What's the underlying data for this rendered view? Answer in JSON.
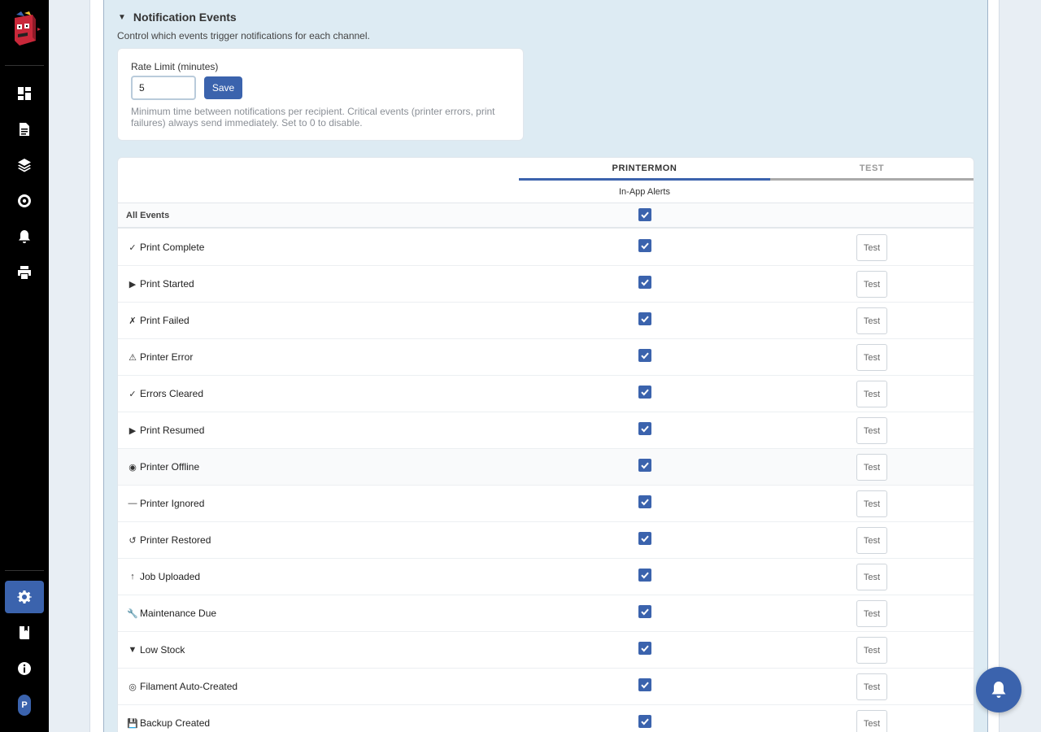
{
  "sidebar": {
    "nav_icons": [
      "dashboard-icon",
      "document-icon",
      "layers-icon",
      "filament-spool-icon",
      "bell-icon",
      "printer-icon"
    ],
    "bottom_icons": [
      "gear-icon",
      "book-icon",
      "info-icon"
    ],
    "user_initial": "P",
    "accent": "#3b63ad"
  },
  "section": {
    "caret": "▼",
    "title": "Notification Events",
    "description": "Control which events trigger notifications for each channel."
  },
  "rate_limit": {
    "label": "Rate Limit (minutes)",
    "value": "5",
    "save_label": "Save",
    "help": "Minimum time between notifications per recipient. Critical events (printer errors, print failures) always send immediately. Set to 0 to disable."
  },
  "table": {
    "columns": [
      {
        "name": "PRINTERMON",
        "sub": "In-App Alerts"
      },
      {
        "name": "TEST",
        "sub": ""
      }
    ],
    "all_events_label": "All Events",
    "test_label": "Test",
    "events": [
      {
        "icon": "✓",
        "label": "Print Complete",
        "checked": true
      },
      {
        "icon": "▶",
        "label": "Print Started",
        "checked": true
      },
      {
        "icon": "✗",
        "label": "Print Failed",
        "checked": true
      },
      {
        "icon": "⚠",
        "label": "Printer Error",
        "checked": true
      },
      {
        "icon": "✓",
        "label": "Errors Cleared",
        "checked": true
      },
      {
        "icon": "▶",
        "label": "Print Resumed",
        "checked": true
      },
      {
        "icon": "◉",
        "label": "Printer Offline",
        "checked": true
      },
      {
        "icon": "—",
        "label": "Printer Ignored",
        "checked": true
      },
      {
        "icon": "↺",
        "label": "Printer Restored",
        "checked": true
      },
      {
        "icon": "↑",
        "label": "Job Uploaded",
        "checked": true
      },
      {
        "icon": "🔧",
        "label": "Maintenance Due",
        "checked": true
      },
      {
        "icon": "▼",
        "label": "Low Stock",
        "checked": true
      },
      {
        "icon": "◎",
        "label": "Filament Auto-Created",
        "checked": true
      },
      {
        "icon": "💾",
        "label": "Backup Created",
        "checked": true
      }
    ]
  }
}
